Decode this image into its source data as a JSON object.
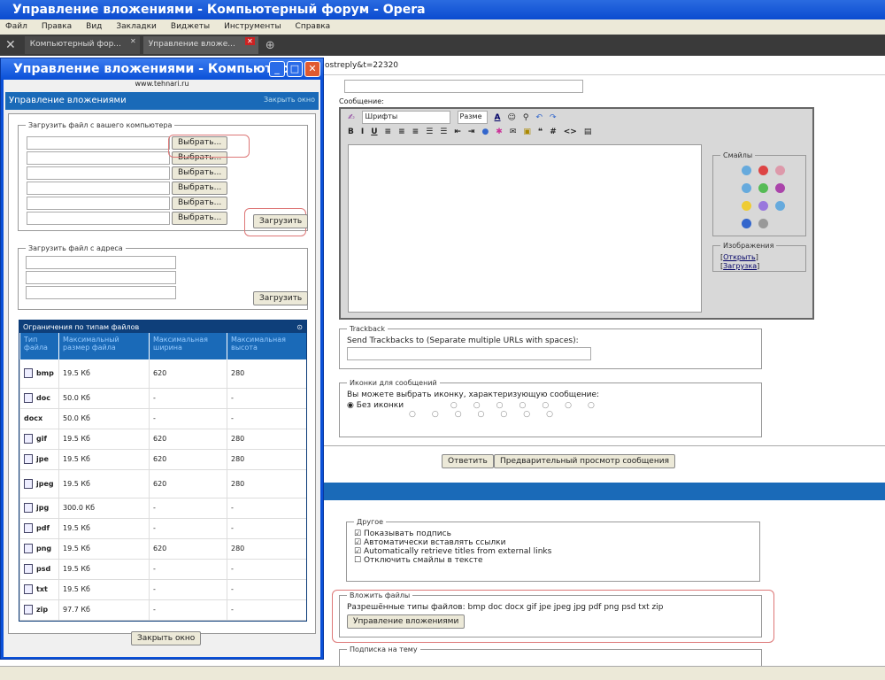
{
  "window": {
    "title": "Управление вложениями - Компьютерный форум - Opera"
  },
  "menu": [
    "Файл",
    "Правка",
    "Вид",
    "Закладки",
    "Виджеты",
    "Инструменты",
    "Справка"
  ],
  "tabs": [
    {
      "label": "Компьютерный фор..."
    },
    {
      "label": "Управление вложе..."
    }
  ],
  "address": "ostreply&t=22320",
  "forum": {
    "message_label": "Сообщение:",
    "font_select": "Шрифты",
    "size_select": "Разме",
    "smilies_label": "Смайлы",
    "images_label": "Изображения",
    "open_link": "Открыть",
    "upload_link": "Загрузка",
    "trackback_legend": "Trackback",
    "trackback_text": "Send Trackbacks to (Separate multiple URLs with spaces):",
    "icons_legend": "Иконки для сообщений",
    "icons_text": "Вы можете выбрать иконку, характеризующую сообщение:",
    "no_icon": "Без иконки",
    "reply_button": "Ответить",
    "preview_button": "Предварительный просмотр сообщения",
    "other_legend": "Другое",
    "options": [
      {
        "label": "Показывать подпись",
        "checked": true
      },
      {
        "label": "Автоматически вставлять ссылки",
        "checked": true
      },
      {
        "label": "Automatically retrieve titles from external links",
        "checked": true
      },
      {
        "label": "Отключить смайлы в тексте",
        "checked": false
      }
    ],
    "attach_legend": "Вложить файлы",
    "allowed_types": "Разрешённые типы файлов: bmp doc docx gif jpe jpeg jpg pdf png psd txt zip",
    "manage_button": "Управление вложениями",
    "subscribe_legend": "Подписка на тему"
  },
  "popup": {
    "title": "Управление вложениями - Компьютер...",
    "site": "www.tehnari.ru",
    "header": "Управление вложениями",
    "close_link": "Закрыть окно",
    "upload_legend": "Загрузить файл с вашего компьютера",
    "browse": "Выбрать...",
    "upload_button": "Загрузить",
    "url_legend": "Загрузить файл с адреса",
    "limits_title": "Ограничения по типам файлов",
    "columns": [
      "Тип файла",
      "Максимальный размер файла",
      "Максимальная ширина",
      "Максимальная высота"
    ],
    "rows": [
      [
        "bmp",
        "19.5 Кб",
        "620",
        "280"
      ],
      [
        "doc",
        "50.0 Кб",
        "-",
        "-"
      ],
      [
        "docx",
        "50.0 Кб",
        "-",
        "-"
      ],
      [
        "gif",
        "19.5 Кб",
        "620",
        "280"
      ],
      [
        "jpe",
        "19.5 Кб",
        "620",
        "280"
      ],
      [
        "jpeg",
        "19.5 Кб",
        "620",
        "280"
      ],
      [
        "jpg",
        "300.0 Кб",
        "-",
        "-"
      ],
      [
        "pdf",
        "19.5 Кб",
        "-",
        "-"
      ],
      [
        "png",
        "19.5 Кб",
        "620",
        "280"
      ],
      [
        "psd",
        "19.5 Кб",
        "-",
        "-"
      ],
      [
        "txt",
        "19.5 Кб",
        "-",
        "-"
      ],
      [
        "zip",
        "97.7 Кб",
        "-",
        "-"
      ]
    ],
    "close_button": "Закрыть окно"
  }
}
